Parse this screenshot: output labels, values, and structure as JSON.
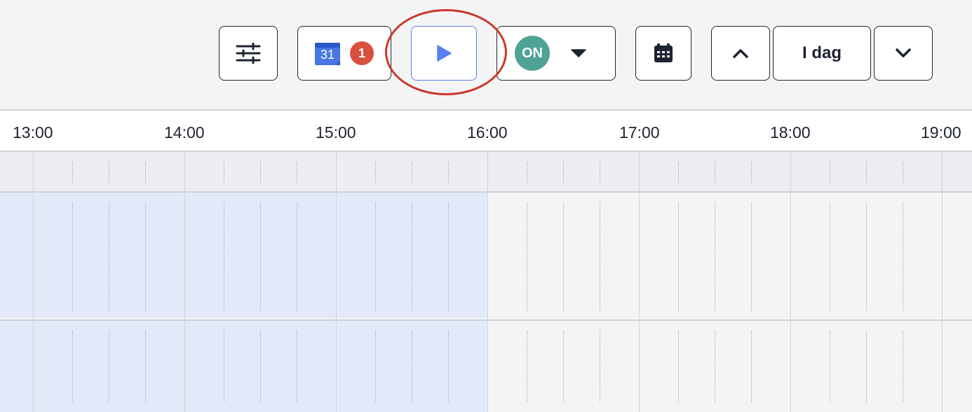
{
  "toolbar": {
    "filters_icon": "sliders-icon",
    "gcal": {
      "icon": "google-calendar-icon",
      "day": "31",
      "badge_count": "1"
    },
    "play_icon": "play-icon",
    "status": {
      "label": "ON",
      "dropdown_icon": "caret-down-icon"
    },
    "datepicker_icon": "calendar-icon",
    "prev_icon": "chevron-up-icon",
    "today_label": "I dag",
    "next_icon": "chevron-down-icon"
  },
  "colors": {
    "accent_blue": "#5b7ff0",
    "status_green": "#4ea396",
    "badge_red": "#d9503f",
    "callout_red": "#c9382b",
    "highlight_blue": "#e3e9f8"
  },
  "timeline": {
    "hours": [
      "13:00",
      "14:00",
      "15:00",
      "16:00",
      "17:00",
      "18:00",
      "19:00"
    ]
  }
}
